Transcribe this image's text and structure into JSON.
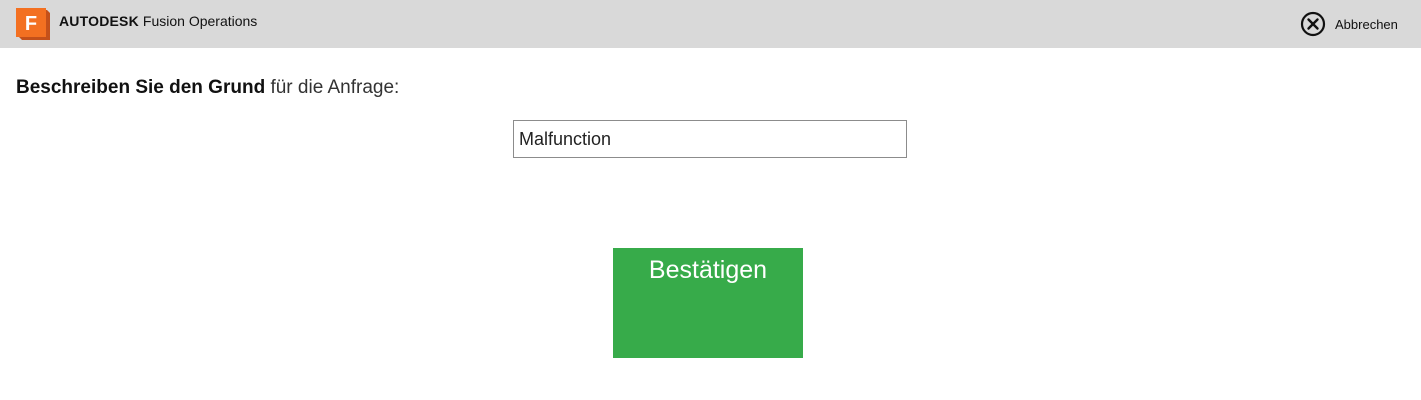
{
  "header": {
    "brand_company": "AUTODESK",
    "brand_product": "Fusion Operations",
    "logo_letter": "F",
    "logo_icon": "autodesk-fusion-logo",
    "cancel_icon": "close-circle-icon",
    "cancel_label": "Abbrechen"
  },
  "main": {
    "prompt_bold": "Beschreiben Sie den Grund",
    "prompt_rest": " für die Anfrage:",
    "reason_value": "Malfunction",
    "confirm_label": "Bestätigen"
  },
  "colors": {
    "header_bg": "#d9d9d9",
    "logo_orange": "#f37021",
    "confirm_green": "#37ab4a"
  }
}
